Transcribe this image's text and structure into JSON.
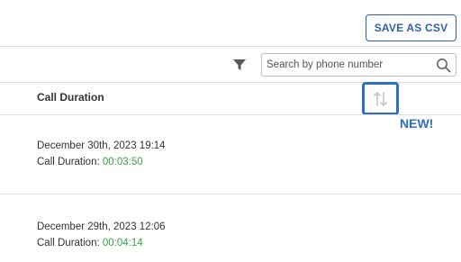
{
  "toolbar": {
    "save_label": "SAVE AS CSV",
    "search_placeholder": "Search by phone number"
  },
  "table": {
    "column_header": "Call Duration",
    "sort_badge": "NEW!",
    "rows": [
      {
        "datetime": "December 30th, 2023 19:14",
        "duration_label": "Call Duration: ",
        "duration_value": "00:03:50"
      },
      {
        "datetime": "December 29th, 2023 12:06",
        "duration_label": "Call Duration: ",
        "duration_value": "00:04:14"
      }
    ]
  },
  "colors": {
    "accent": "#2f6fc3",
    "button_text": "#2f5fa8",
    "duration_value": "#3aa14a",
    "divider": "#dddddd"
  },
  "icons": [
    "filter-icon",
    "search-icon",
    "sort-icon"
  ]
}
